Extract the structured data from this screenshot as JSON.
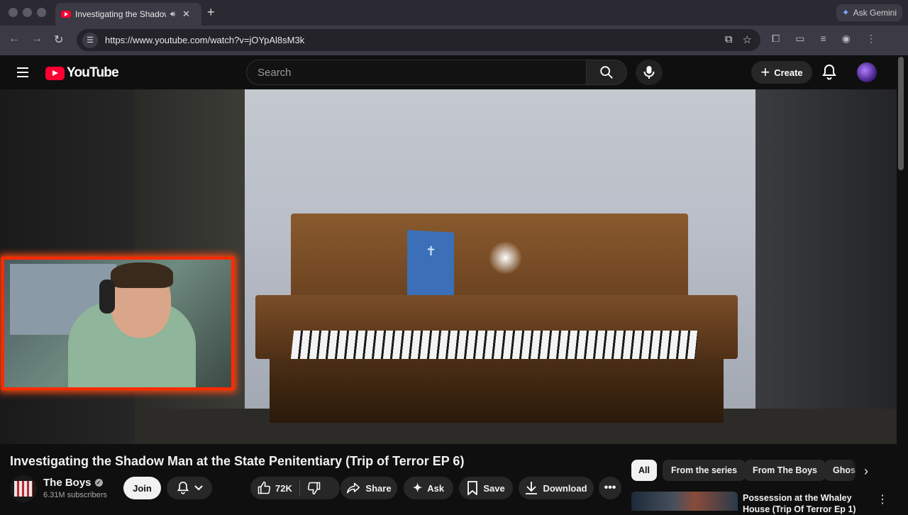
{
  "browser": {
    "tab_title": "Investigating the Shadow",
    "url": "https://www.youtube.com/watch?v=jOYpAl8sM3k",
    "gemini_label": "Ask Gemini"
  },
  "youtube": {
    "logo_text": "YouTube",
    "search_placeholder": "Search",
    "create_label": "Create"
  },
  "video": {
    "title": "Investigating the Shadow Man at the State Penitentiary (Trip of Terror EP 6)"
  },
  "channel": {
    "name": "The Boys",
    "subscribers": "6.31M subscribers",
    "join_label": "Join"
  },
  "actions": {
    "like_count": "72K",
    "share_label": "Share",
    "ask_label": "Ask",
    "save_label": "Save",
    "download_label": "Download"
  },
  "chips": {
    "all": "All",
    "series": "From the series",
    "from_channel": "From The Boys",
    "ghost": "Ghos"
  },
  "recommended": {
    "title": "Possession at the Whaley House (Trip Of Terror Ep 1)"
  },
  "colors": {
    "youtube_red": "#ff0033",
    "webcam_border": "#ff2a00",
    "background": "#0f0f0f"
  }
}
